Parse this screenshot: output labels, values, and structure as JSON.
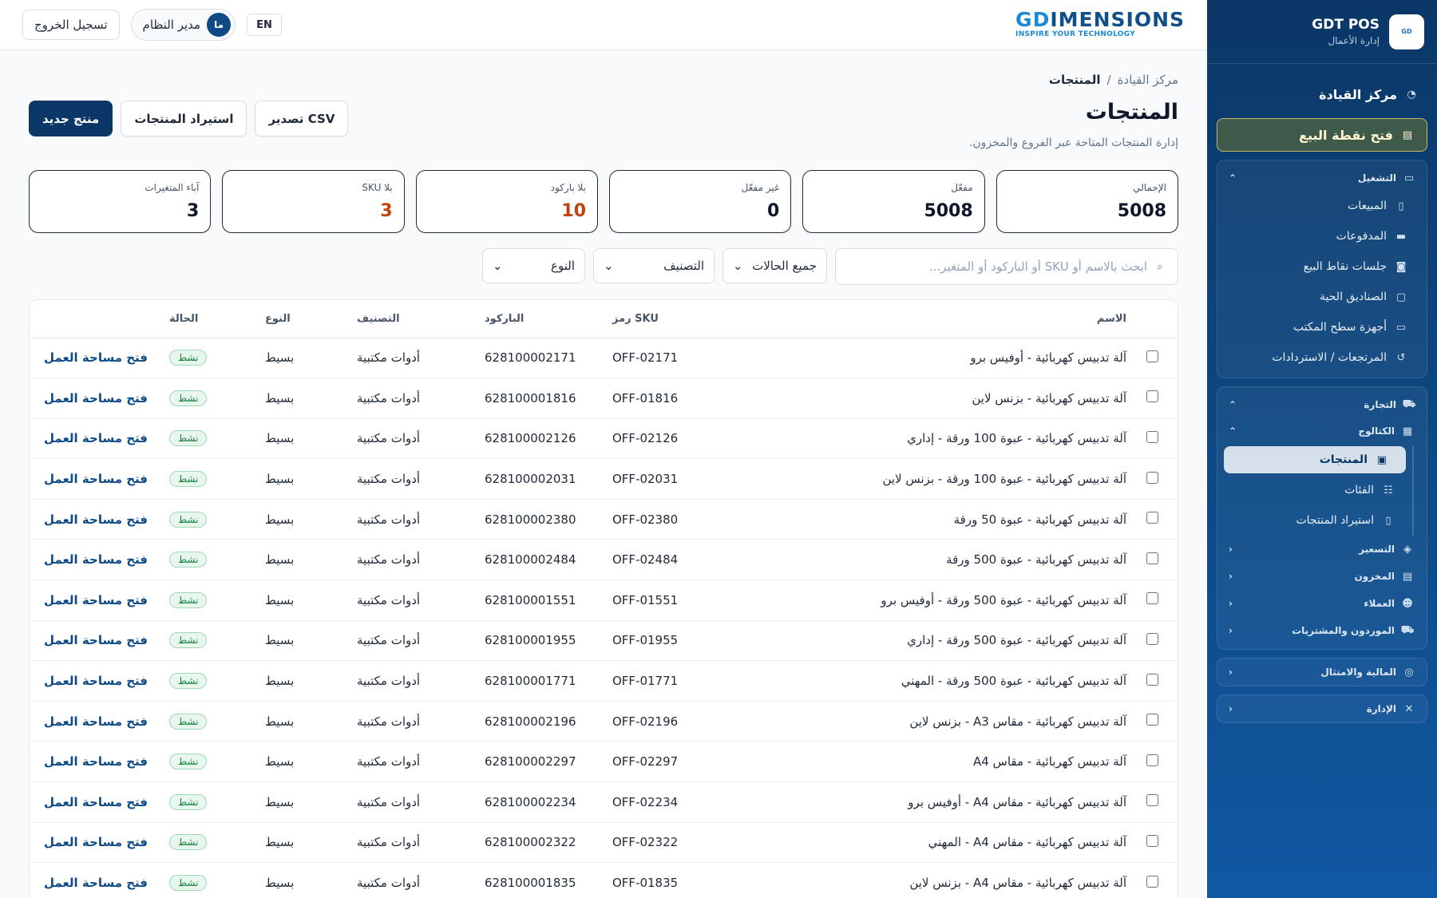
{
  "sidebar": {
    "brand_name": "GDT POS",
    "brand_sub": "إدارة الأعمال",
    "dashboard": "مركز القيادة",
    "pos_button": "فتح نقطة البيع",
    "operations": {
      "title": "التشغيل",
      "items": [
        {
          "label": "المبيعات",
          "icon": "receipt-icon"
        },
        {
          "label": "المدفوعات",
          "icon": "card-icon"
        },
        {
          "label": "جلسات نقاط البيع",
          "icon": "cash-icon"
        },
        {
          "label": "الصناديق الحية",
          "icon": "drawer-icon"
        },
        {
          "label": "أجهزة سطح المكتب",
          "icon": "desktop-icon"
        },
        {
          "label": "المرتجعات / الاستردادات",
          "icon": "undo-icon"
        }
      ]
    },
    "commerce": {
      "title": "التجارة",
      "catalog": {
        "title": "الكتالوج",
        "items": [
          {
            "label": "المنتجات",
            "icon": "box-icon",
            "active": true
          },
          {
            "label": "الفئات",
            "icon": "tree-icon"
          },
          {
            "label": "استيراد المنتجات",
            "icon": "file-icon"
          }
        ]
      },
      "subgroups": [
        {
          "label": "التسعير",
          "icon": "tag-icon"
        },
        {
          "label": "المخزون",
          "icon": "warehouse-icon"
        },
        {
          "label": "العملاء",
          "icon": "users-icon"
        },
        {
          "label": "الموردون والمشتريات",
          "icon": "truck-icon"
        }
      ]
    },
    "finance": "المالية والامتثال",
    "admin": "الإدارة"
  },
  "topbar": {
    "logo_gd": "GD",
    "logo_rest": "IMENSIONS",
    "logo_tagline": "INSPIRE YOUR TECHNOLOGY",
    "logout": "تسجيل الخروج",
    "avatar_initials": "ما",
    "user_name": "مدير النظام",
    "lang": "EN"
  },
  "page": {
    "breadcrumb_root": "مركز القيادة",
    "breadcrumb_sep": "/",
    "breadcrumb_current": "المنتجات",
    "title": "المنتجات",
    "subtitle": "إدارة المنتجات المتاحة عبر الفروع والمخزون.",
    "btn_new": "منتج جديد",
    "btn_import": "استيراد المنتجات",
    "btn_export": "تصدير CSV"
  },
  "stats": [
    {
      "label": "الإجمالي",
      "value": "5008",
      "warn": false
    },
    {
      "label": "مفعّل",
      "value": "5008",
      "warn": false
    },
    {
      "label": "غير مفعّل",
      "value": "0",
      "warn": false
    },
    {
      "label": "بلا باركود",
      "value": "10",
      "warn": true
    },
    {
      "label": "بلا SKU",
      "value": "3",
      "warn": true
    },
    {
      "label": "آباء المتغيرات",
      "value": "3",
      "warn": false
    }
  ],
  "filters": {
    "search_placeholder": "ابحث بالاسم أو SKU أو الباركود أو المتغير...",
    "status": "جميع الحالات",
    "category": "التصنيف",
    "type": "النوع"
  },
  "table": {
    "headers": {
      "name": "الاسم",
      "sku": "رمز SKU",
      "barcode": "الباركود",
      "category": "التصنيف",
      "type": "النوع",
      "status": "الحالة"
    },
    "rows": [
      {
        "name": "آلة تدبيس كهربائية - أوفيس برو",
        "sku": "OFF-02171",
        "barcode": "628100002171",
        "category": "أدوات مكتبية",
        "type": "بسيط",
        "status": "نشط",
        "action": "فتح مساحة العمل"
      },
      {
        "name": "آلة تدبيس كهربائية - بزنس لاين",
        "sku": "OFF-01816",
        "barcode": "628100001816",
        "category": "أدوات مكتبية",
        "type": "بسيط",
        "status": "نشط",
        "action": "فتح مساحة العمل"
      },
      {
        "name": "آلة تدبيس كهربائية - عبوة 100 ورقة - إداري",
        "sku": "OFF-02126",
        "barcode": "628100002126",
        "category": "أدوات مكتبية",
        "type": "بسيط",
        "status": "نشط",
        "action": "فتح مساحة العمل"
      },
      {
        "name": "آلة تدبيس كهربائية - عبوة 100 ورقة - بزنس لاين",
        "sku": "OFF-02031",
        "barcode": "628100002031",
        "category": "أدوات مكتبية",
        "type": "بسيط",
        "status": "نشط",
        "action": "فتح مساحة العمل"
      },
      {
        "name": "آلة تدبيس كهربائية - عبوة 50 ورقة",
        "sku": "OFF-02380",
        "barcode": "628100002380",
        "category": "أدوات مكتبية",
        "type": "بسيط",
        "status": "نشط",
        "action": "فتح مساحة العمل"
      },
      {
        "name": "آلة تدبيس كهربائية - عبوة 500 ورقة",
        "sku": "OFF-02484",
        "barcode": "628100002484",
        "category": "أدوات مكتبية",
        "type": "بسيط",
        "status": "نشط",
        "action": "فتح مساحة العمل"
      },
      {
        "name": "آلة تدبيس كهربائية - عبوة 500 ورقة - أوفيس برو",
        "sku": "OFF-01551",
        "barcode": "628100001551",
        "category": "أدوات مكتبية",
        "type": "بسيط",
        "status": "نشط",
        "action": "فتح مساحة العمل"
      },
      {
        "name": "آلة تدبيس كهربائية - عبوة 500 ورقة - إداري",
        "sku": "OFF-01955",
        "barcode": "628100001955",
        "category": "أدوات مكتبية",
        "type": "بسيط",
        "status": "نشط",
        "action": "فتح مساحة العمل"
      },
      {
        "name": "آلة تدبيس كهربائية - عبوة 500 ورقة - المهني",
        "sku": "OFF-01771",
        "barcode": "628100001771",
        "category": "أدوات مكتبية",
        "type": "بسيط",
        "status": "نشط",
        "action": "فتح مساحة العمل"
      },
      {
        "name": "آلة تدبيس كهربائية - مقاس A3 - بزنس لاين",
        "sku": "OFF-02196",
        "barcode": "628100002196",
        "category": "أدوات مكتبية",
        "type": "بسيط",
        "status": "نشط",
        "action": "فتح مساحة العمل"
      },
      {
        "name": "آلة تدبيس كهربائية - مقاس A4",
        "sku": "OFF-02297",
        "barcode": "628100002297",
        "category": "أدوات مكتبية",
        "type": "بسيط",
        "status": "نشط",
        "action": "فتح مساحة العمل"
      },
      {
        "name": "آلة تدبيس كهربائية - مقاس A4 - أوفيس برو",
        "sku": "OFF-02234",
        "barcode": "628100002234",
        "category": "أدوات مكتبية",
        "type": "بسيط",
        "status": "نشط",
        "action": "فتح مساحة العمل"
      },
      {
        "name": "آلة تدبيس كهربائية - مقاس A4 - المهني",
        "sku": "OFF-02322",
        "barcode": "628100002322",
        "category": "أدوات مكتبية",
        "type": "بسيط",
        "status": "نشط",
        "action": "فتح مساحة العمل"
      },
      {
        "name": "آلة تدبيس كهربائية - مقاس A4 - بزنس لاين",
        "sku": "OFF-01835",
        "barcode": "628100001835",
        "category": "أدوات مكتبية",
        "type": "بسيط",
        "status": "نشط",
        "action": "فتح مساحة العمل"
      }
    ]
  },
  "colors": {
    "sidebar_top": "#0b3766",
    "sidebar_bottom": "#1158a3",
    "primary": "#0b3766",
    "warn": "#c2410c",
    "badge_green": "#15803d"
  }
}
